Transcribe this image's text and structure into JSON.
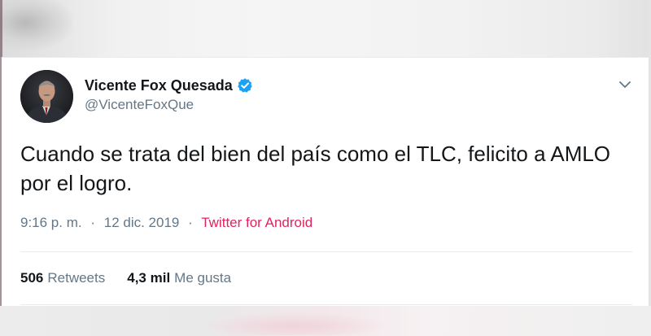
{
  "tweet": {
    "display_name": "Vicente Fox Quesada",
    "handle": "@VicenteFoxQue",
    "verified": true,
    "text": "Cuando se trata del bien del país como el TLC, felicito a AMLO por el logro.",
    "time": "9:16 p. m.",
    "separator": "·",
    "date": "12 dic. 2019",
    "source": "Twitter for Android",
    "retweets_count": "506",
    "retweets_label": "Retweets",
    "likes_count": "4,3 mil",
    "likes_label": "Me gusta"
  },
  "icons": {
    "verified": "verified-badge-icon",
    "menu": "chevron-down-icon"
  },
  "colors": {
    "name": "#14171a",
    "secondary": "#657786",
    "source_link": "#e0245e",
    "verified": "#1da1f2",
    "divider": "#e6ecf0"
  }
}
